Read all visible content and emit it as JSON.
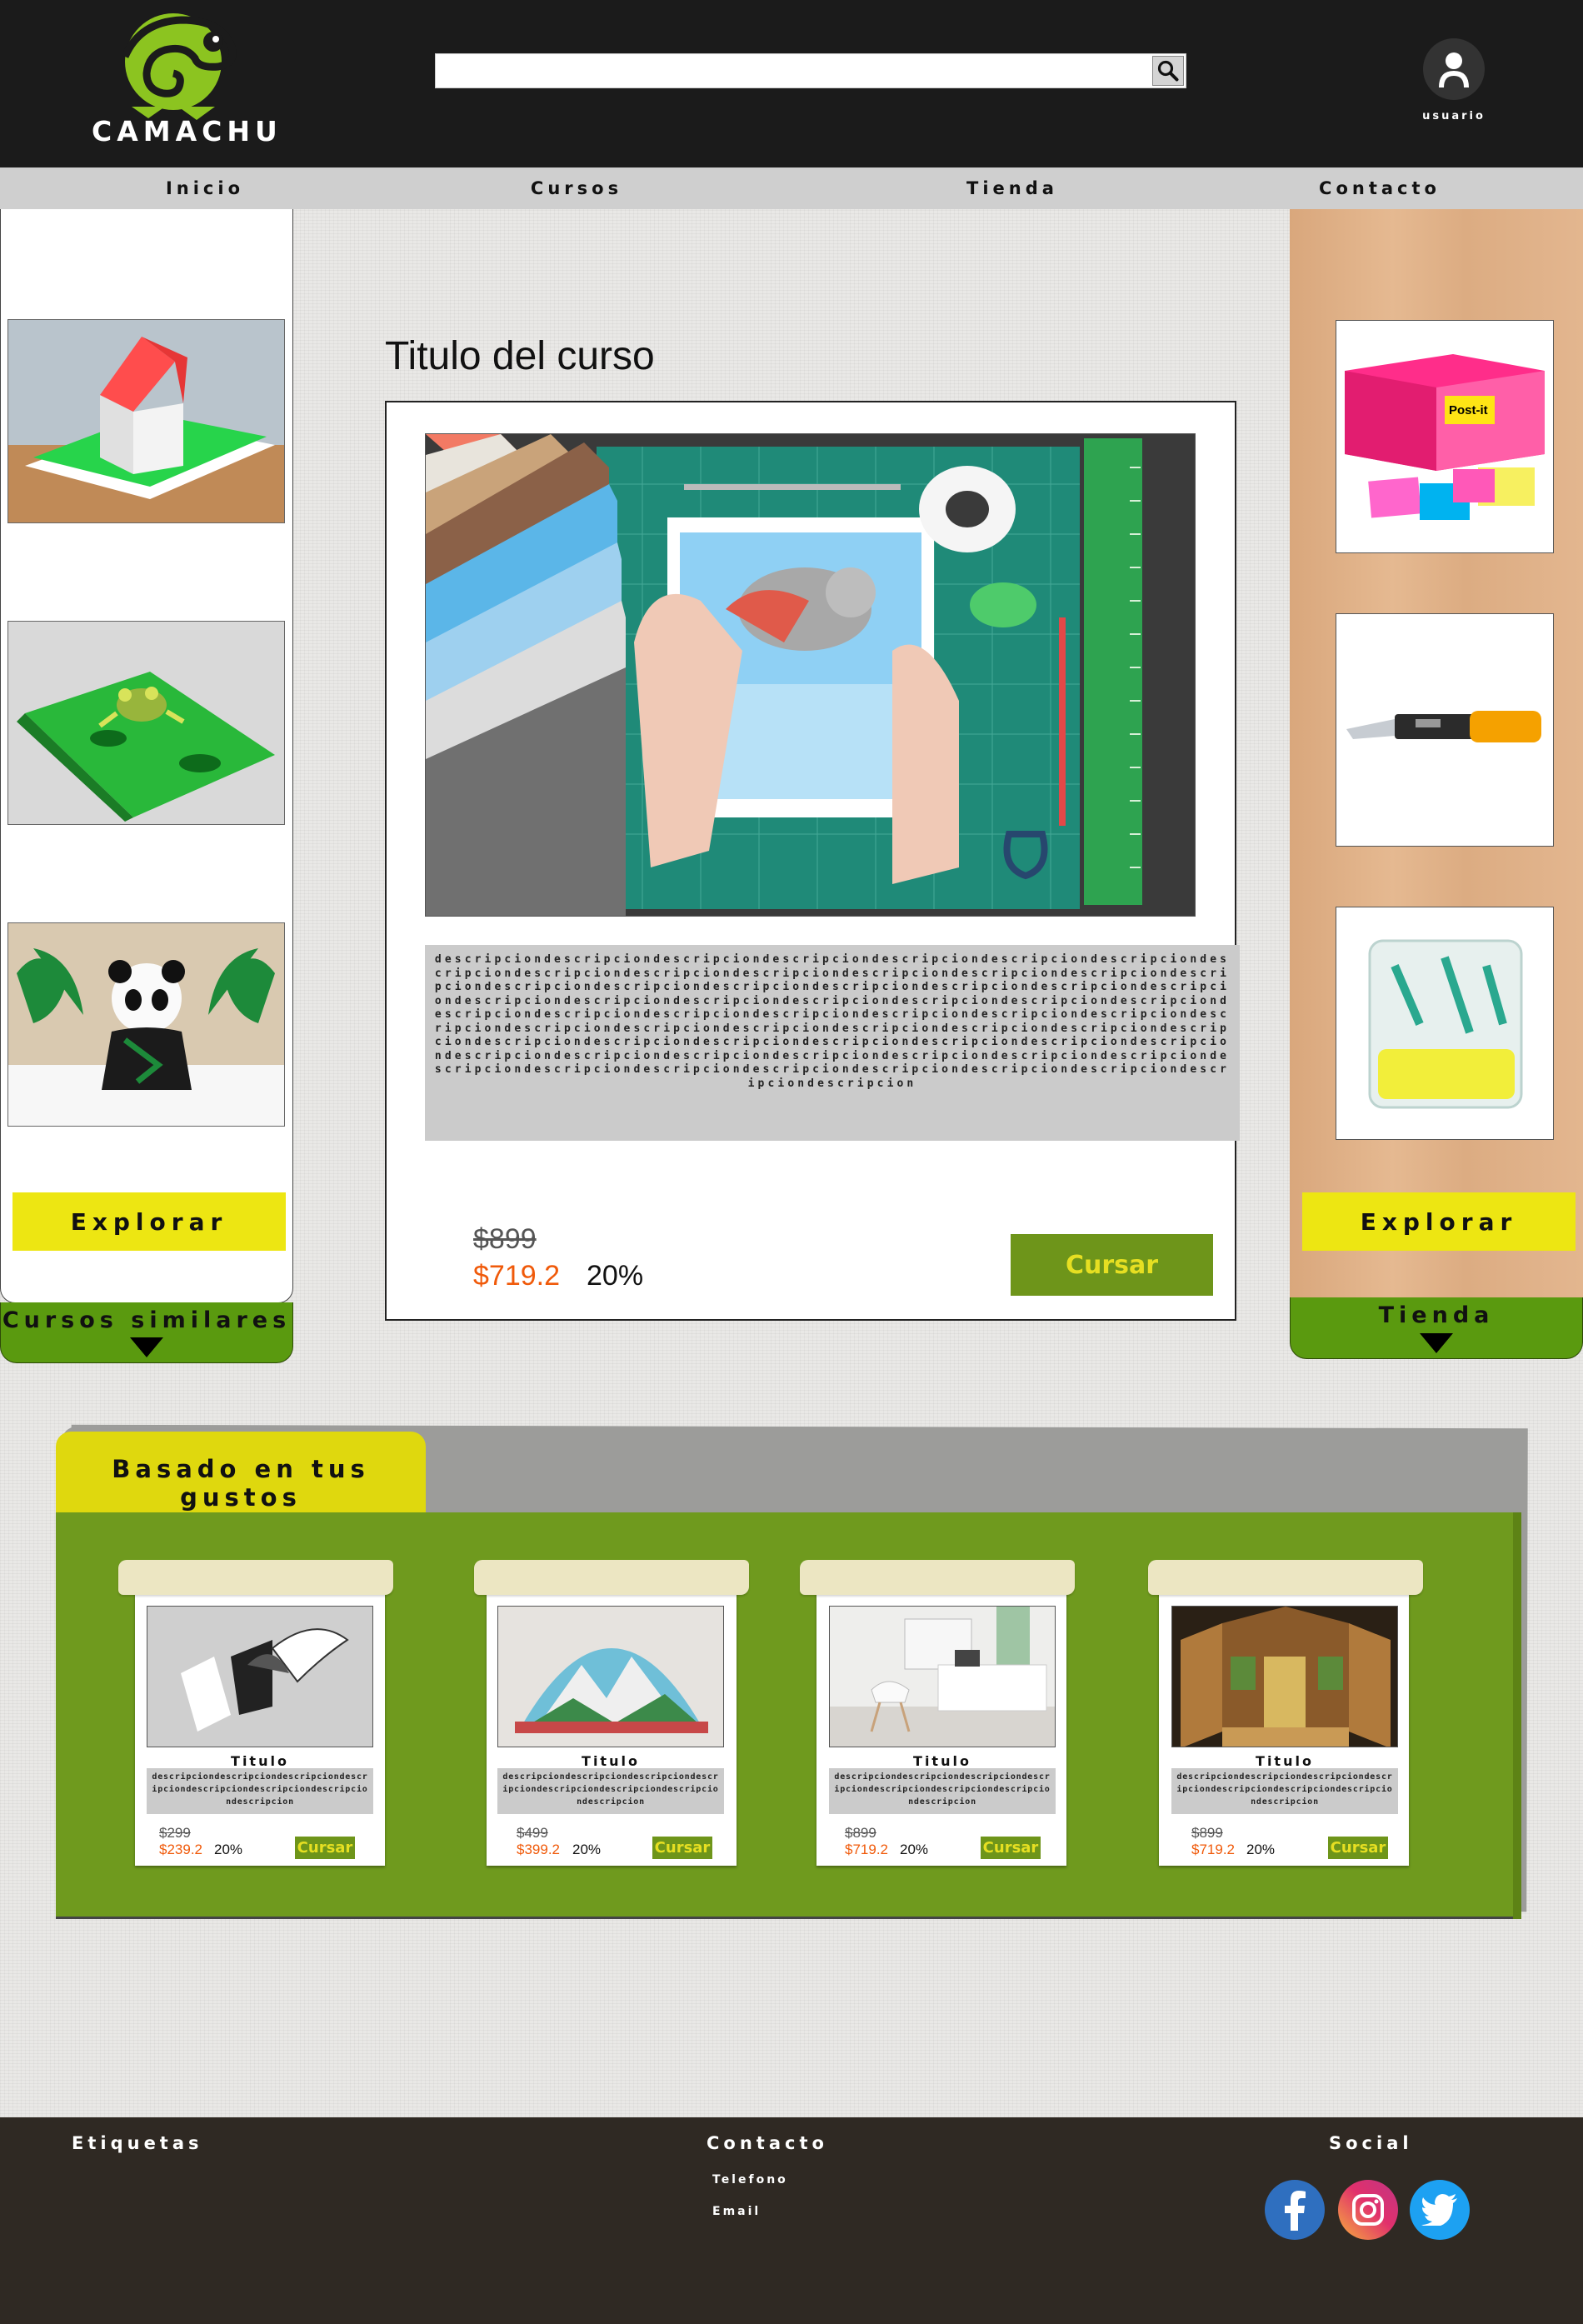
{
  "header": {
    "logo_text": "CAMACHU",
    "search": {
      "value": "",
      "placeholder": ""
    },
    "user_label": "usuario"
  },
  "nav": {
    "items": [
      {
        "label": "Inicio"
      },
      {
        "label": "Cursos"
      },
      {
        "label": "Tienda"
      },
      {
        "label": "Contacto"
      }
    ]
  },
  "left_panel": {
    "thumbnails": [
      "paper-house-popup",
      "frog-popup",
      "panda-popup"
    ],
    "explore_label": "Explorar",
    "tab_label": "Cursos similares"
  },
  "right_panel": {
    "products": [
      "post-it-notes",
      "utility-knife",
      "glue-sticks"
    ],
    "explore_label": "Explorar",
    "tab_label": "Tienda"
  },
  "course": {
    "title": "Titulo del curso",
    "description": "descripciondescripciondescripciondescripciondescripciondescripciondescripciondescripciondescripciondescripciondescripciondescripciondescripciondescripciondescripciondescripciondescripciondescripciondescripciondescripciondescripciondescripciondescripciondescripciondescripciondescripciondescripciondescripciondescripciondescripciondescripciondescripciondescripciondescripciondescripciondescripciondescripciondescripciondescripciondescripciondescripciondescripciondescripciondescripciondescripciondescripciondescripciondescripciondescripciondescripciondescripciondescripciondescripciondescripciondescripciondescripciondescripciondescripciondescripciondescripciondescripciondescripciondescripciondescripciondescripciondescripciondescripcion",
    "old_price": "$899",
    "new_price": "$719.2",
    "discount": "20%",
    "button_label": "Cursar"
  },
  "recommendations": {
    "tab_label": "Basado en tus gustos",
    "cards": [
      {
        "title": "Titulo",
        "description": "descripciondescripciondescripciondescripciondescripciondescripciondescripciondescripcion",
        "old_price": "$299",
        "new_price": "$239.2",
        "discount": "20%",
        "button_label": "Cursar"
      },
      {
        "title": "Titulo",
        "description": "descripciondescripciondescripciondescripciondescripciondescripciondescripciondescripcion",
        "old_price": "$499",
        "new_price": "$399.2",
        "discount": "20%",
        "button_label": "Cursar"
      },
      {
        "title": "Titulo",
        "description": "descripciondescripciondescripciondescripciondescripciondescripciondescripciondescripcion",
        "old_price": "$899",
        "new_price": "$719.2",
        "discount": "20%",
        "button_label": "Cursar"
      },
      {
        "title": "Titulo",
        "description": "descripciondescripciondescripciondescripciondescripciondescripciondescripciondescripcion",
        "old_price": "$899",
        "new_price": "$719.2",
        "discount": "20%",
        "button_label": "Cursar"
      }
    ]
  },
  "footer": {
    "etiquetas": "Etiquetas",
    "contacto": "Contacto",
    "telefono": "Telefono",
    "email": "Email",
    "social": "Social",
    "social_icons": [
      "facebook-icon",
      "instagram-icon",
      "twitter-icon"
    ]
  },
  "colors": {
    "header_bg": "#1b1b1b",
    "nav_bg": "#cfcfcf",
    "accent_green": "#6f9a1e",
    "tab_green": "#5a9a0f",
    "button_green": "#6e951a",
    "button_text": "#e6df22",
    "explore_yellow": "#ede612",
    "price_orange": "#f05a0a",
    "footer_bg": "#2f2923"
  }
}
